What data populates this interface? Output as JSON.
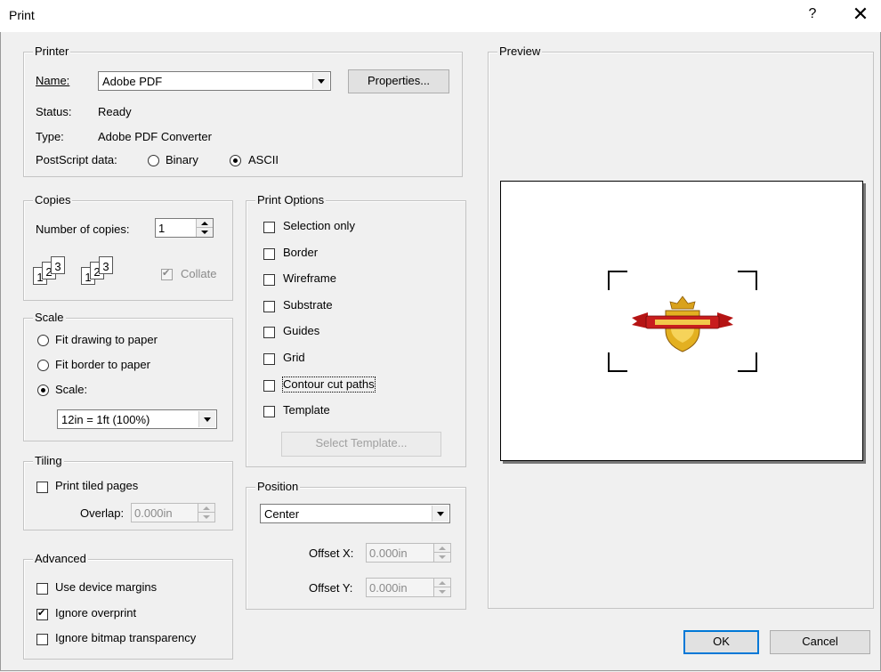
{
  "window": {
    "title": "Print",
    "help_label": "?",
    "close_label": "✕"
  },
  "printer": {
    "legend": "Printer",
    "name_label": "Name:",
    "name_value": "Adobe PDF",
    "properties_label": "Properties...",
    "status_label": "Status:",
    "status_value": "Ready",
    "type_label": "Type:",
    "type_value": "Adobe PDF Converter",
    "postscript_label": "PostScript data:",
    "binary_label": "Binary",
    "ascii_label": "ASCII",
    "postscript_selected": "ASCII"
  },
  "copies": {
    "legend": "Copies",
    "number_label": "Number of copies:",
    "number_value": "1",
    "collate_label": "Collate",
    "collate_checked": true
  },
  "scale": {
    "legend": "Scale",
    "fit_drawing_label": "Fit drawing to paper",
    "fit_border_label": "Fit border to paper",
    "scale_label": "Scale:",
    "selected": "Scale:",
    "scale_value": "12in = 1ft (100%)"
  },
  "tiling": {
    "legend": "Tiling",
    "print_tiled_label": "Print tiled pages",
    "overlap_label": "Overlap:",
    "overlap_value": "0.000in"
  },
  "advanced": {
    "legend": "Advanced",
    "use_device_margins_label": "Use device margins",
    "ignore_overprint_label": "Ignore overprint",
    "ignore_overprint_checked": true,
    "ignore_bitmap_label": "Ignore bitmap transparency"
  },
  "print_options": {
    "legend": "Print Options",
    "items": [
      {
        "label": "Selection only",
        "checked": false
      },
      {
        "label": "Border",
        "checked": false
      },
      {
        "label": "Wireframe",
        "checked": false
      },
      {
        "label": "Substrate",
        "checked": false
      },
      {
        "label": "Guides",
        "checked": false
      },
      {
        "label": "Grid",
        "checked": false
      },
      {
        "label": "Contour cut paths",
        "checked": false
      },
      {
        "label": "Template",
        "checked": false
      }
    ],
    "select_template_label": "Select Template..."
  },
  "position": {
    "legend": "Position",
    "value": "Center",
    "offset_x_label": "Offset X:",
    "offset_x_value": "0.000in",
    "offset_y_label": "Offset Y:",
    "offset_y_value": "0.000in"
  },
  "preview": {
    "legend": "Preview"
  },
  "footer": {
    "ok_label": "OK",
    "cancel_label": "Cancel"
  },
  "colors": {
    "dialog_bg": "#f0f0f0",
    "default_button_border": "#0078d7"
  }
}
